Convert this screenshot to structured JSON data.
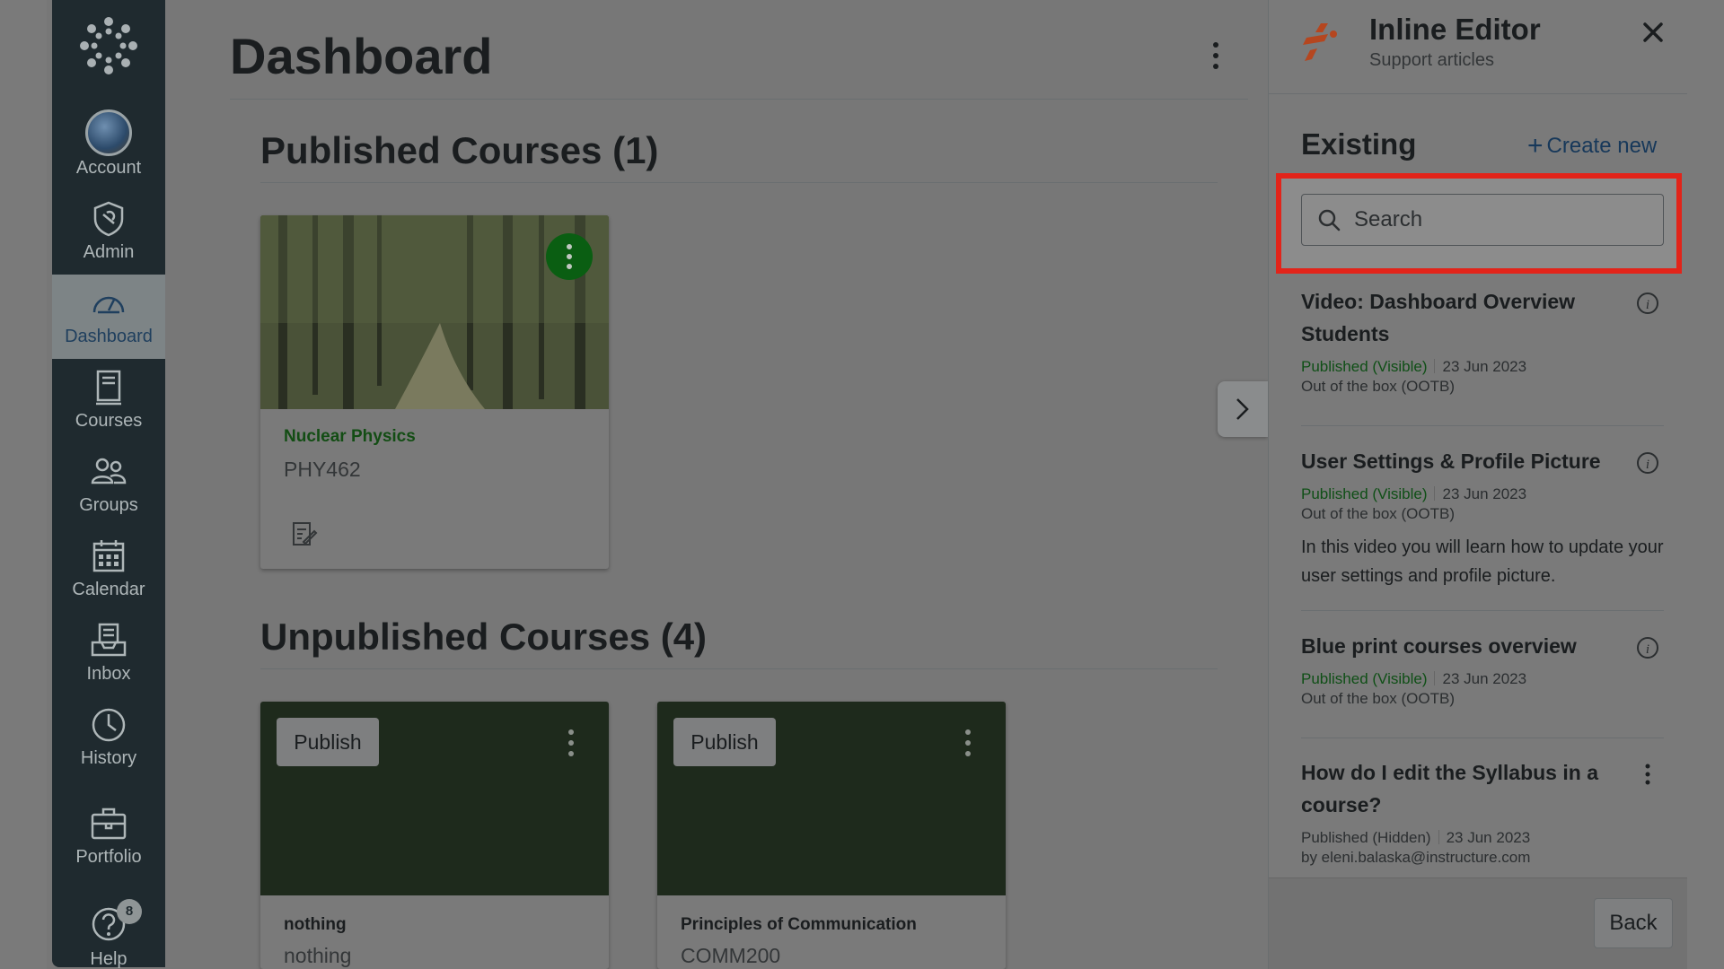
{
  "nav": {
    "items": [
      {
        "key": "account",
        "label": "Account",
        "icon": "avatar"
      },
      {
        "key": "admin",
        "label": "Admin",
        "icon": "admin-shield-icon"
      },
      {
        "key": "dashboard",
        "label": "Dashboard",
        "icon": "dashboard-gauge-icon",
        "active": true
      },
      {
        "key": "courses",
        "label": "Courses",
        "icon": "courses-book-icon"
      },
      {
        "key": "groups",
        "label": "Groups",
        "icon": "groups-people-icon"
      },
      {
        "key": "calendar",
        "label": "Calendar",
        "icon": "calendar-icon"
      },
      {
        "key": "inbox",
        "label": "Inbox",
        "icon": "inbox-tray-icon"
      },
      {
        "key": "history",
        "label": "History",
        "icon": "history-clock-icon"
      },
      {
        "key": "portfolio",
        "label": "Portfolio",
        "icon": "portfolio-briefcase-icon"
      },
      {
        "key": "help",
        "label": "Help",
        "icon": "help-question-icon",
        "badge": "8"
      }
    ]
  },
  "main": {
    "title": "Dashboard",
    "published": {
      "heading": "Published Courses (1)",
      "cards": [
        {
          "name": "Nuclear Physics",
          "code": "PHY462"
        }
      ]
    },
    "unpublished": {
      "heading": "Unpublished Courses (4)",
      "cards": [
        {
          "name": "nothing",
          "code": "nothing",
          "publish_label": "Publish"
        },
        {
          "name": "Principles of Communication",
          "code": "COMM200",
          "publish_label": "Publish"
        }
      ]
    }
  },
  "tray": {
    "title": "Inline Editor",
    "subtitle": "Support articles",
    "section": "Existing",
    "create_new": "Create new",
    "search_placeholder": "Search",
    "articles": [
      {
        "title": "Video: Dashboard Overview Students",
        "status": "Published (Visible)",
        "date": "23 Jun 2023",
        "source": "Out of the box (OOTB)"
      },
      {
        "title": "User Settings & Profile Picture",
        "status": "Published (Visible)",
        "date": "23 Jun 2023",
        "source": "Out of the box (OOTB)",
        "description": "In this video you will learn how to update your user settings and profile picture."
      },
      {
        "title": "Blue print courses overview",
        "status": "Published (Visible)",
        "date": "23 Jun 2023",
        "source": "Out of the box (OOTB)"
      },
      {
        "title": "How do I edit the Syllabus in a course?",
        "status": "Published (Hidden)",
        "date": "23 Jun 2023",
        "source": "by eleni.balaska@instructure.com"
      }
    ],
    "back_label": "Back"
  },
  "colors": {
    "highlight": "#e2241a",
    "nav_bg": "#1f2a2f",
    "published_green": "#0f4f16",
    "link_blue": "#17385a"
  }
}
